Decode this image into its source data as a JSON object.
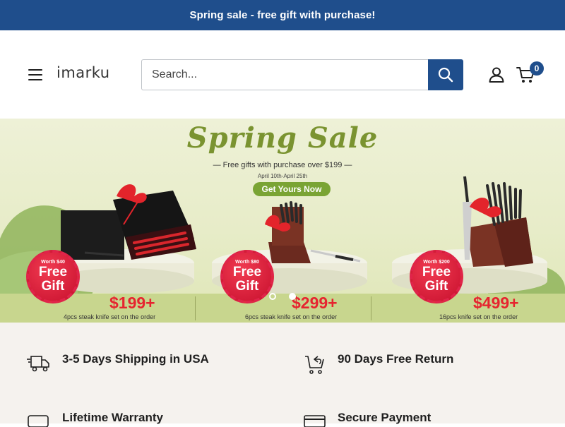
{
  "announcement": {
    "text": "Spring sale - free gift with purchase!"
  },
  "header": {
    "logo": "imarku",
    "search": {
      "placeholder": "Search...",
      "value": ""
    },
    "cart_count": "0"
  },
  "banner": {
    "title": "Spring Sale",
    "subtitle": "— Free gifts with purchase over $199 —",
    "date": "April 10th-April 25th",
    "cta": "Get Yours Now",
    "offers": [
      {
        "worth": "Worth $40",
        "free_line1": "Free",
        "free_line2": "Gift",
        "price": "$199+",
        "note": "4pcs steak knife set on the order"
      },
      {
        "worth": "Worth $80",
        "free_line1": "Free",
        "free_line2": "Gift",
        "price": "$299+",
        "note": "6pcs steak knife set on the order"
      },
      {
        "worth": "Worth $200",
        "free_line1": "Free",
        "free_line2": "Gift",
        "price": "$499+",
        "note": "16pcs knife set on the order"
      }
    ],
    "slides_total": 2,
    "slide_active": 2
  },
  "features": [
    {
      "icon": "truck-icon",
      "label": "3-5 Days Shipping in USA"
    },
    {
      "icon": "return-cart-icon",
      "label": "90 Days Free Return"
    },
    {
      "icon": "warranty-icon",
      "label": "Lifetime Warranty"
    },
    {
      "icon": "credit-card-icon",
      "label": "Secure Payment"
    }
  ],
  "colors": {
    "brand": "#1f4e8c",
    "sale_red": "#e6242f",
    "banner_green": "#7a9330",
    "features_bg": "#f5f2ee"
  }
}
